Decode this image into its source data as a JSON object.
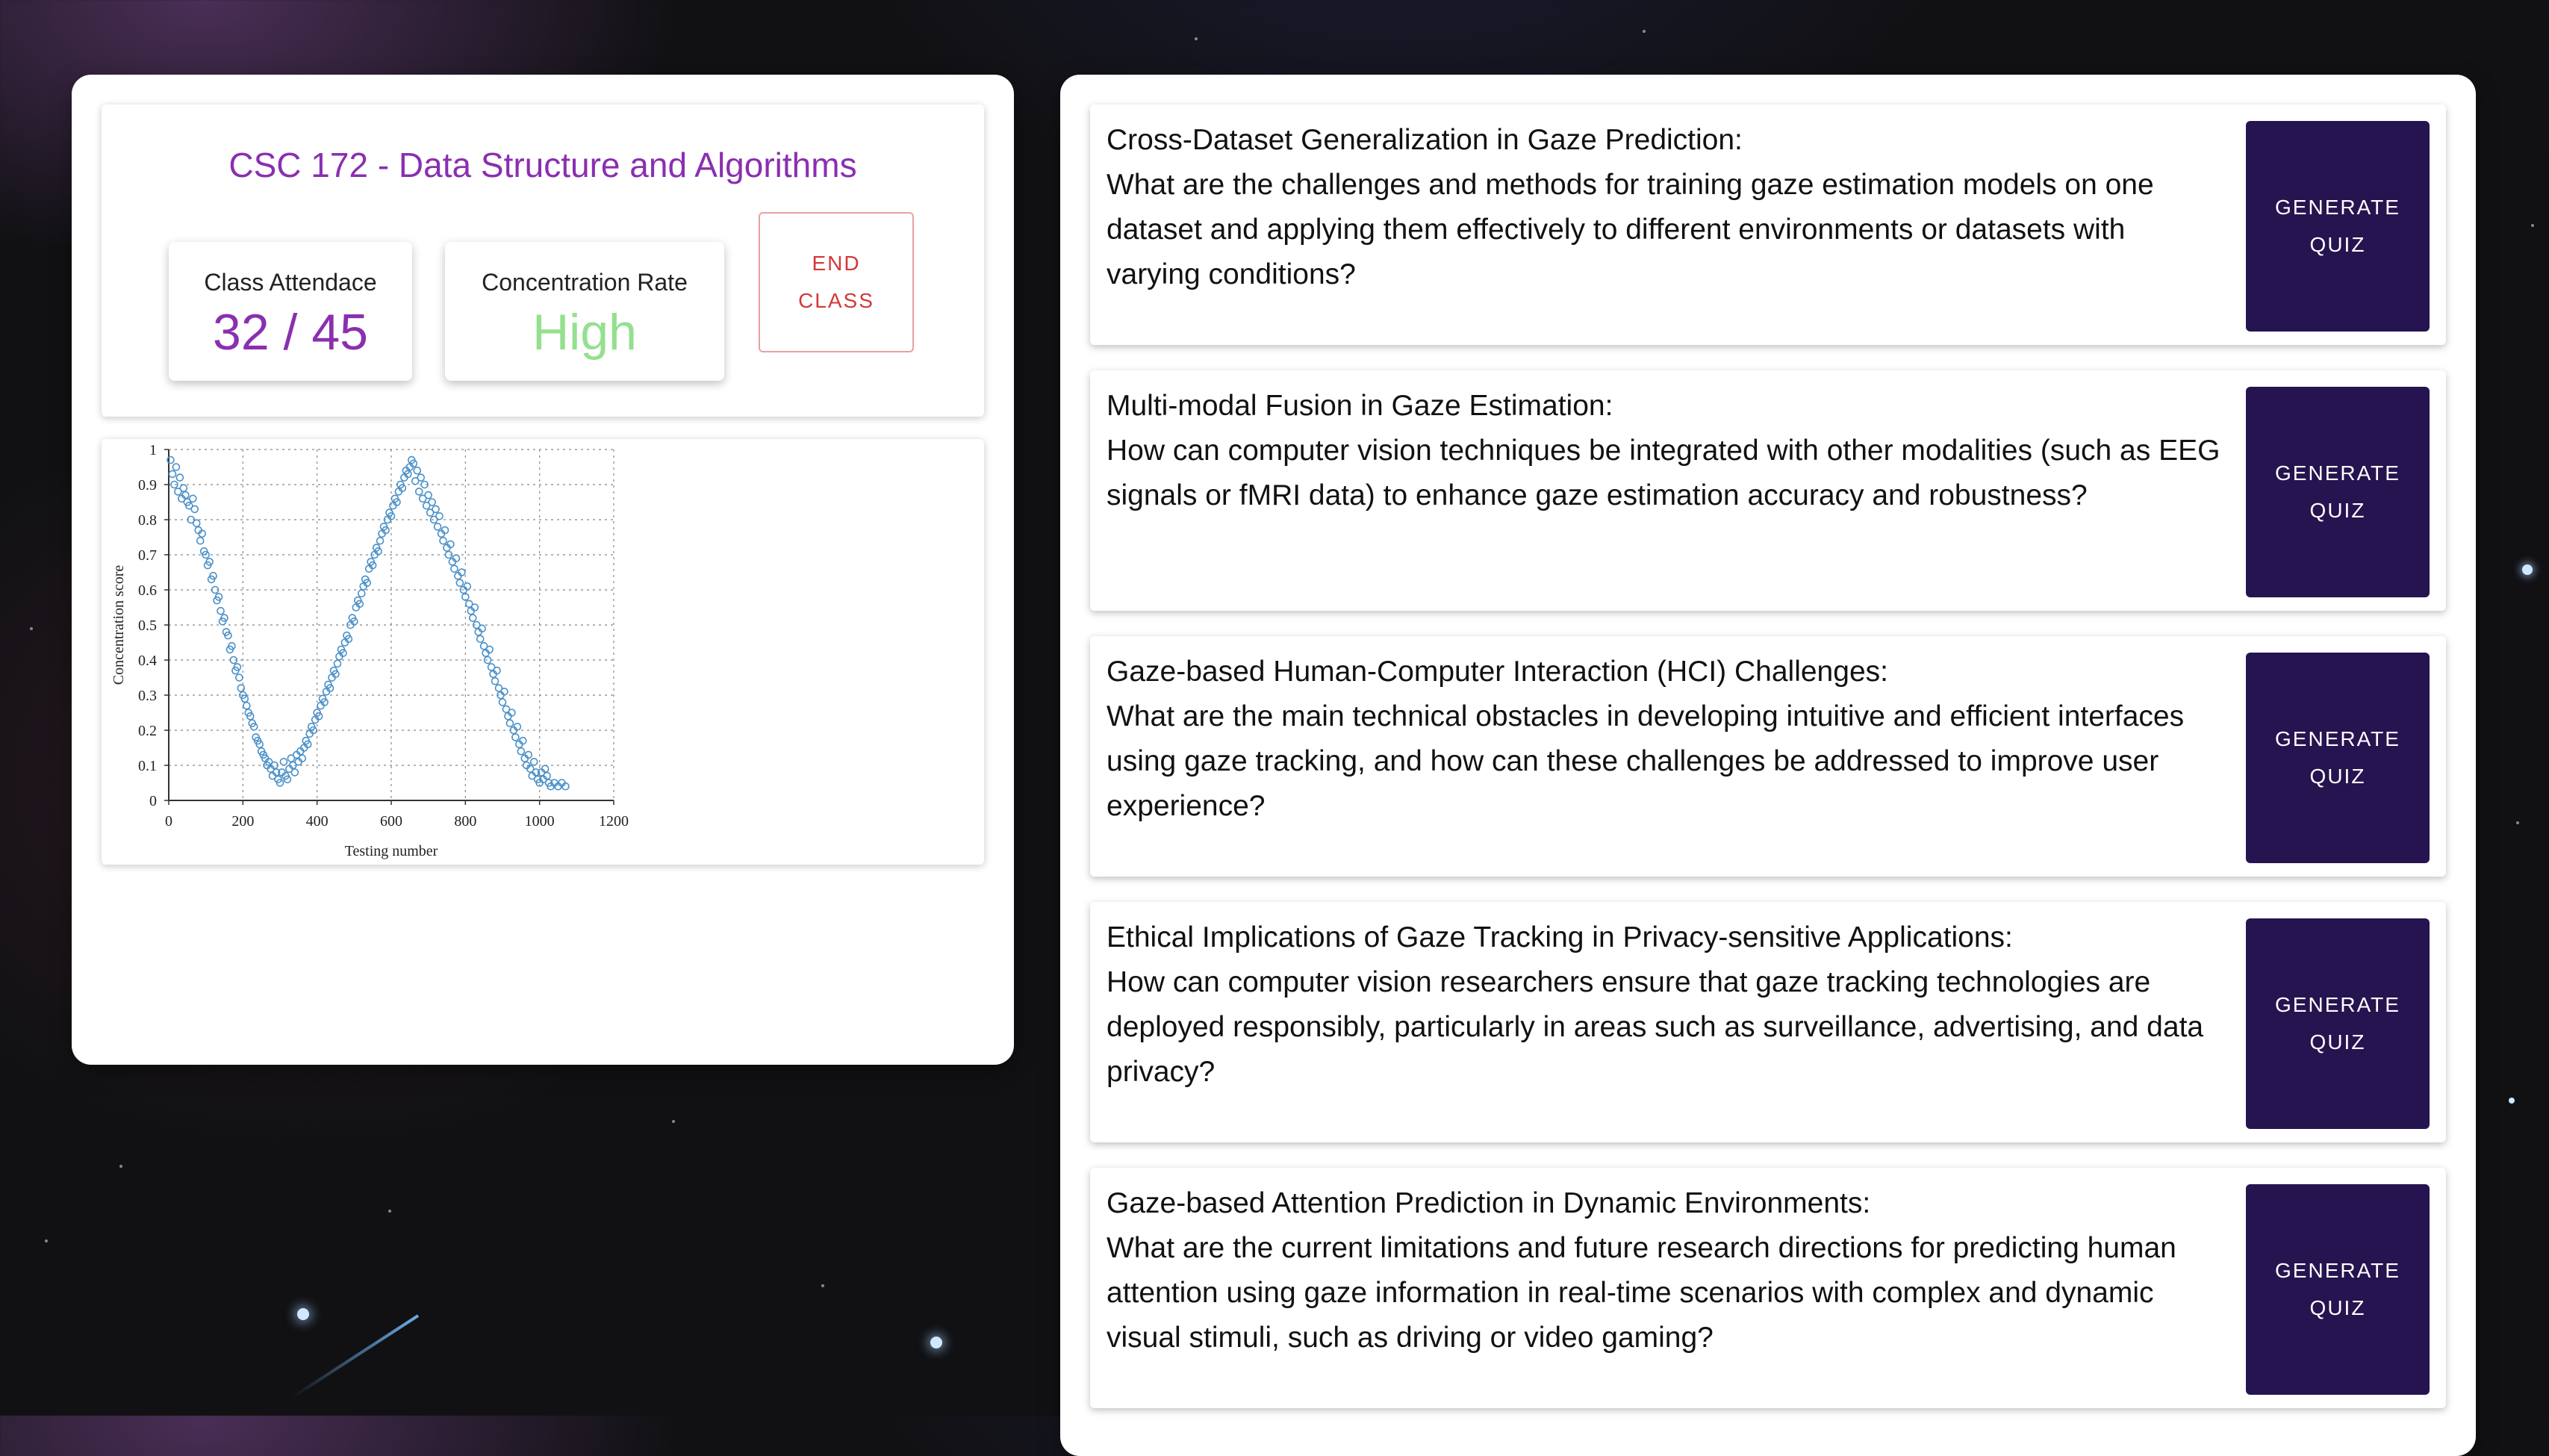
{
  "class_info": {
    "course_title": "CSC 172 - Data Structure and Algorithms",
    "attendance_label": "Class Attendace",
    "attendance_value": "32 / 45",
    "concentration_label": "Concentration Rate",
    "concentration_value": "High",
    "end_class_label": "END CLASS"
  },
  "colors": {
    "accent_purple": "#8a2fb0",
    "concentration_green": "#94e08e",
    "end_class_red": "#d33838",
    "quiz_button_bg": "#25144f",
    "scatter_point": "#4a90c8"
  },
  "chart_data": {
    "type": "scatter",
    "xlabel": "Testing number",
    "ylabel": "Concentration score",
    "xlim": [
      0,
      1200
    ],
    "ylim": [
      0,
      1
    ],
    "xticks": [
      "0",
      "200",
      "400",
      "600",
      "800",
      "1000",
      "1200"
    ],
    "yticks": [
      "0",
      "0.1",
      "0.2",
      "0.3",
      "0.4",
      "0.5",
      "0.6",
      "0.7",
      "0.8",
      "0.9",
      "1"
    ],
    "grid": true,
    "marker": "open-circle",
    "series": [
      {
        "points": [
          [
            5,
            0.97
          ],
          [
            10,
            0.93
          ],
          [
            15,
            0.9
          ],
          [
            20,
            0.95
          ],
          [
            25,
            0.88
          ],
          [
            30,
            0.92
          ],
          [
            35,
            0.86
          ],
          [
            40,
            0.89
          ],
          [
            45,
            0.87
          ],
          [
            50,
            0.85
          ],
          [
            55,
            0.84
          ],
          [
            60,
            0.8
          ],
          [
            65,
            0.86
          ],
          [
            70,
            0.83
          ],
          [
            75,
            0.79
          ],
          [
            80,
            0.77
          ],
          [
            85,
            0.74
          ],
          [
            90,
            0.76
          ],
          [
            95,
            0.71
          ],
          [
            100,
            0.7
          ],
          [
            105,
            0.67
          ],
          [
            110,
            0.68
          ],
          [
            115,
            0.63
          ],
          [
            120,
            0.64
          ],
          [
            125,
            0.6
          ],
          [
            130,
            0.57
          ],
          [
            135,
            0.58
          ],
          [
            140,
            0.54
          ],
          [
            145,
            0.51
          ],
          [
            150,
            0.52
          ],
          [
            155,
            0.48
          ],
          [
            160,
            0.47
          ],
          [
            165,
            0.43
          ],
          [
            170,
            0.44
          ],
          [
            175,
            0.4
          ],
          [
            180,
            0.37
          ],
          [
            185,
            0.38
          ],
          [
            190,
            0.35
          ],
          [
            195,
            0.32
          ],
          [
            200,
            0.3
          ],
          [
            205,
            0.29
          ],
          [
            210,
            0.27
          ],
          [
            215,
            0.25
          ],
          [
            220,
            0.24
          ],
          [
            225,
            0.22
          ],
          [
            230,
            0.21
          ],
          [
            235,
            0.18
          ],
          [
            240,
            0.17
          ],
          [
            245,
            0.16
          ],
          [
            250,
            0.14
          ],
          [
            255,
            0.13
          ],
          [
            260,
            0.12
          ],
          [
            265,
            0.1
          ],
          [
            270,
            0.11
          ],
          [
            275,
            0.09
          ],
          [
            280,
            0.07
          ],
          [
            285,
            0.1
          ],
          [
            290,
            0.08
          ],
          [
            295,
            0.06
          ],
          [
            300,
            0.05
          ],
          [
            305,
            0.08
          ],
          [
            310,
            0.11
          ],
          [
            315,
            0.07
          ],
          [
            320,
            0.06
          ],
          [
            325,
            0.09
          ],
          [
            330,
            0.12
          ],
          [
            335,
            0.1
          ],
          [
            340,
            0.08
          ],
          [
            345,
            0.13
          ],
          [
            350,
            0.11
          ],
          [
            355,
            0.14
          ],
          [
            360,
            0.12
          ],
          [
            365,
            0.15
          ],
          [
            370,
            0.17
          ],
          [
            375,
            0.16
          ],
          [
            380,
            0.19
          ],
          [
            385,
            0.21
          ],
          [
            390,
            0.2
          ],
          [
            395,
            0.23
          ],
          [
            400,
            0.25
          ],
          [
            405,
            0.24
          ],
          [
            410,
            0.27
          ],
          [
            415,
            0.29
          ],
          [
            420,
            0.28
          ],
          [
            425,
            0.31
          ],
          [
            430,
            0.33
          ],
          [
            435,
            0.32
          ],
          [
            440,
            0.35
          ],
          [
            445,
            0.37
          ],
          [
            450,
            0.36
          ],
          [
            455,
            0.39
          ],
          [
            460,
            0.41
          ],
          [
            465,
            0.43
          ],
          [
            470,
            0.42
          ],
          [
            475,
            0.45
          ],
          [
            480,
            0.47
          ],
          [
            485,
            0.46
          ],
          [
            490,
            0.5
          ],
          [
            495,
            0.52
          ],
          [
            500,
            0.51
          ],
          [
            505,
            0.55
          ],
          [
            510,
            0.57
          ],
          [
            515,
            0.56
          ],
          [
            520,
            0.59
          ],
          [
            525,
            0.61
          ],
          [
            530,
            0.63
          ],
          [
            535,
            0.62
          ],
          [
            540,
            0.66
          ],
          [
            545,
            0.68
          ],
          [
            550,
            0.67
          ],
          [
            555,
            0.7
          ],
          [
            560,
            0.72
          ],
          [
            565,
            0.71
          ],
          [
            570,
            0.74
          ],
          [
            575,
            0.76
          ],
          [
            580,
            0.78
          ],
          [
            585,
            0.77
          ],
          [
            590,
            0.8
          ],
          [
            595,
            0.82
          ],
          [
            600,
            0.81
          ],
          [
            605,
            0.84
          ],
          [
            610,
            0.86
          ],
          [
            615,
            0.85
          ],
          [
            620,
            0.88
          ],
          [
            625,
            0.9
          ],
          [
            630,
            0.89
          ],
          [
            635,
            0.92
          ],
          [
            640,
            0.94
          ],
          [
            645,
            0.93
          ],
          [
            650,
            0.95
          ],
          [
            655,
            0.97
          ],
          [
            660,
            0.96
          ],
          [
            665,
            0.91
          ],
          [
            670,
            0.94
          ],
          [
            675,
            0.88
          ],
          [
            680,
            0.92
          ],
          [
            685,
            0.86
          ],
          [
            690,
            0.9
          ],
          [
            695,
            0.84
          ],
          [
            700,
            0.87
          ],
          [
            705,
            0.82
          ],
          [
            710,
            0.85
          ],
          [
            715,
            0.8
          ],
          [
            720,
            0.83
          ],
          [
            725,
            0.78
          ],
          [
            730,
            0.81
          ],
          [
            735,
            0.76
          ],
          [
            740,
            0.74
          ],
          [
            745,
            0.77
          ],
          [
            750,
            0.72
          ],
          [
            755,
            0.7
          ],
          [
            760,
            0.73
          ],
          [
            765,
            0.68
          ],
          [
            770,
            0.66
          ],
          [
            775,
            0.69
          ],
          [
            780,
            0.64
          ],
          [
            785,
            0.62
          ],
          [
            790,
            0.65
          ],
          [
            795,
            0.6
          ],
          [
            800,
            0.58
          ],
          [
            805,
            0.61
          ],
          [
            810,
            0.56
          ],
          [
            815,
            0.54
          ],
          [
            820,
            0.52
          ],
          [
            825,
            0.55
          ],
          [
            830,
            0.5
          ],
          [
            835,
            0.48
          ],
          [
            840,
            0.46
          ],
          [
            845,
            0.49
          ],
          [
            850,
            0.44
          ],
          [
            855,
            0.42
          ],
          [
            860,
            0.4
          ],
          [
            865,
            0.43
          ],
          [
            870,
            0.38
          ],
          [
            875,
            0.36
          ],
          [
            880,
            0.34
          ],
          [
            885,
            0.37
          ],
          [
            890,
            0.32
          ],
          [
            895,
            0.3
          ],
          [
            900,
            0.28
          ],
          [
            905,
            0.31
          ],
          [
            910,
            0.26
          ],
          [
            915,
            0.24
          ],
          [
            920,
            0.22
          ],
          [
            925,
            0.25
          ],
          [
            930,
            0.2
          ],
          [
            935,
            0.18
          ],
          [
            940,
            0.21
          ],
          [
            945,
            0.16
          ],
          [
            950,
            0.14
          ],
          [
            955,
            0.17
          ],
          [
            960,
            0.12
          ],
          [
            965,
            0.1
          ],
          [
            970,
            0.13
          ],
          [
            975,
            0.09
          ],
          [
            980,
            0.07
          ],
          [
            985,
            0.11
          ],
          [
            990,
            0.08
          ],
          [
            995,
            0.06
          ],
          [
            1000,
            0.05
          ],
          [
            1005,
            0.08
          ],
          [
            1010,
            0.06
          ],
          [
            1015,
            0.09
          ],
          [
            1020,
            0.07
          ],
          [
            1025,
            0.05
          ],
          [
            1030,
            0.04
          ],
          [
            1040,
            0.05
          ],
          [
            1050,
            0.04
          ],
          [
            1060,
            0.05
          ],
          [
            1070,
            0.04
          ]
        ]
      }
    ]
  },
  "questions": [
    {
      "title": "Cross-Dataset Generalization in Gaze Prediction:",
      "body": "What are the challenges and methods for training gaze estimation models on one dataset and applying them effectively to different environments or datasets with varying conditions?",
      "button_label": "GENERATE QUIZ"
    },
    {
      "title": "Multi-modal Fusion in Gaze Estimation:",
      "body": "How can computer vision techniques be integrated with other modalities (such as EEG signals or fMRI data) to enhance gaze estimation accuracy and robustness?",
      "button_label": "GENERATE QUIZ"
    },
    {
      "title": "Gaze-based Human-Computer Interaction (HCI) Challenges:",
      "body": "What are the main technical obstacles in developing intuitive and efficient interfaces using gaze tracking, and how can these challenges be addressed to improve user experience?",
      "button_label": "GENERATE QUIZ"
    },
    {
      "title": "Ethical Implications of Gaze Tracking in Privacy-sensitive Applications:",
      "body": "How can computer vision researchers ensure that gaze tracking technologies are deployed responsibly, particularly in areas such as surveillance, advertising, and data privacy?",
      "button_label": "GENERATE QUIZ"
    },
    {
      "title": "Gaze-based Attention Prediction in Dynamic Environments:",
      "body": "What are the current limitations and future research directions for predicting human attention using gaze information in real-time scenarios with complex and dynamic visual stimuli, such as driving or video gaming?",
      "button_label": "GENERATE QUIZ"
    }
  ]
}
